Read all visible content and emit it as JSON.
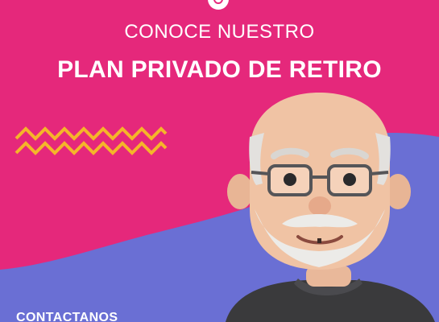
{
  "eyebrow": "CONOCE NUESTRO",
  "headline": "PLAN PRIVADO DE RETIRO",
  "cta_label": "CONTACTANOS",
  "colors": {
    "background": "#e5287b",
    "blob": "#6a6fd4",
    "zigzag": "#f5b52a",
    "text": "#ffffff"
  },
  "icons": [
    "logo-icon",
    "zigzag-decoration",
    "elderly-man-avatar"
  ]
}
